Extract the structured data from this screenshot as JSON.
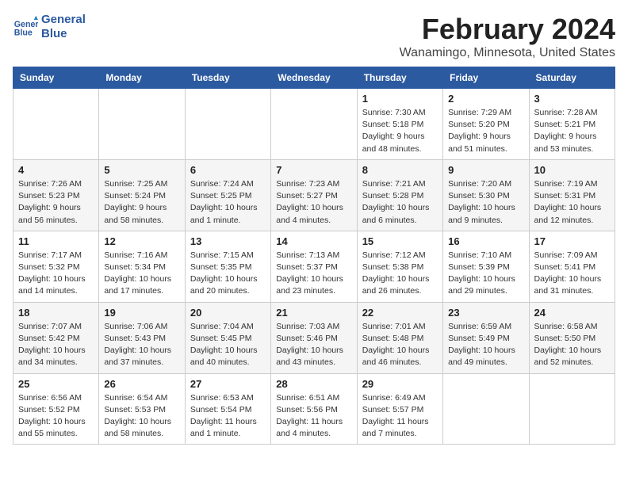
{
  "header": {
    "logo_line1": "General",
    "logo_line2": "Blue",
    "month_year": "February 2024",
    "location": "Wanamingo, Minnesota, United States"
  },
  "weekdays": [
    "Sunday",
    "Monday",
    "Tuesday",
    "Wednesday",
    "Thursday",
    "Friday",
    "Saturday"
  ],
  "weeks": [
    [
      {
        "day": "",
        "info": ""
      },
      {
        "day": "",
        "info": ""
      },
      {
        "day": "",
        "info": ""
      },
      {
        "day": "",
        "info": ""
      },
      {
        "day": "1",
        "info": "Sunrise: 7:30 AM\nSunset: 5:18 PM\nDaylight: 9 hours\nand 48 minutes."
      },
      {
        "day": "2",
        "info": "Sunrise: 7:29 AM\nSunset: 5:20 PM\nDaylight: 9 hours\nand 51 minutes."
      },
      {
        "day": "3",
        "info": "Sunrise: 7:28 AM\nSunset: 5:21 PM\nDaylight: 9 hours\nand 53 minutes."
      }
    ],
    [
      {
        "day": "4",
        "info": "Sunrise: 7:26 AM\nSunset: 5:23 PM\nDaylight: 9 hours\nand 56 minutes."
      },
      {
        "day": "5",
        "info": "Sunrise: 7:25 AM\nSunset: 5:24 PM\nDaylight: 9 hours\nand 58 minutes."
      },
      {
        "day": "6",
        "info": "Sunrise: 7:24 AM\nSunset: 5:25 PM\nDaylight: 10 hours\nand 1 minute."
      },
      {
        "day": "7",
        "info": "Sunrise: 7:23 AM\nSunset: 5:27 PM\nDaylight: 10 hours\nand 4 minutes."
      },
      {
        "day": "8",
        "info": "Sunrise: 7:21 AM\nSunset: 5:28 PM\nDaylight: 10 hours\nand 6 minutes."
      },
      {
        "day": "9",
        "info": "Sunrise: 7:20 AM\nSunset: 5:30 PM\nDaylight: 10 hours\nand 9 minutes."
      },
      {
        "day": "10",
        "info": "Sunrise: 7:19 AM\nSunset: 5:31 PM\nDaylight: 10 hours\nand 12 minutes."
      }
    ],
    [
      {
        "day": "11",
        "info": "Sunrise: 7:17 AM\nSunset: 5:32 PM\nDaylight: 10 hours\nand 14 minutes."
      },
      {
        "day": "12",
        "info": "Sunrise: 7:16 AM\nSunset: 5:34 PM\nDaylight: 10 hours\nand 17 minutes."
      },
      {
        "day": "13",
        "info": "Sunrise: 7:15 AM\nSunset: 5:35 PM\nDaylight: 10 hours\nand 20 minutes."
      },
      {
        "day": "14",
        "info": "Sunrise: 7:13 AM\nSunset: 5:37 PM\nDaylight: 10 hours\nand 23 minutes."
      },
      {
        "day": "15",
        "info": "Sunrise: 7:12 AM\nSunset: 5:38 PM\nDaylight: 10 hours\nand 26 minutes."
      },
      {
        "day": "16",
        "info": "Sunrise: 7:10 AM\nSunset: 5:39 PM\nDaylight: 10 hours\nand 29 minutes."
      },
      {
        "day": "17",
        "info": "Sunrise: 7:09 AM\nSunset: 5:41 PM\nDaylight: 10 hours\nand 31 minutes."
      }
    ],
    [
      {
        "day": "18",
        "info": "Sunrise: 7:07 AM\nSunset: 5:42 PM\nDaylight: 10 hours\nand 34 minutes."
      },
      {
        "day": "19",
        "info": "Sunrise: 7:06 AM\nSunset: 5:43 PM\nDaylight: 10 hours\nand 37 minutes."
      },
      {
        "day": "20",
        "info": "Sunrise: 7:04 AM\nSunset: 5:45 PM\nDaylight: 10 hours\nand 40 minutes."
      },
      {
        "day": "21",
        "info": "Sunrise: 7:03 AM\nSunset: 5:46 PM\nDaylight: 10 hours\nand 43 minutes."
      },
      {
        "day": "22",
        "info": "Sunrise: 7:01 AM\nSunset: 5:48 PM\nDaylight: 10 hours\nand 46 minutes."
      },
      {
        "day": "23",
        "info": "Sunrise: 6:59 AM\nSunset: 5:49 PM\nDaylight: 10 hours\nand 49 minutes."
      },
      {
        "day": "24",
        "info": "Sunrise: 6:58 AM\nSunset: 5:50 PM\nDaylight: 10 hours\nand 52 minutes."
      }
    ],
    [
      {
        "day": "25",
        "info": "Sunrise: 6:56 AM\nSunset: 5:52 PM\nDaylight: 10 hours\nand 55 minutes."
      },
      {
        "day": "26",
        "info": "Sunrise: 6:54 AM\nSunset: 5:53 PM\nDaylight: 10 hours\nand 58 minutes."
      },
      {
        "day": "27",
        "info": "Sunrise: 6:53 AM\nSunset: 5:54 PM\nDaylight: 11 hours\nand 1 minute."
      },
      {
        "day": "28",
        "info": "Sunrise: 6:51 AM\nSunset: 5:56 PM\nDaylight: 11 hours\nand 4 minutes."
      },
      {
        "day": "29",
        "info": "Sunrise: 6:49 AM\nSunset: 5:57 PM\nDaylight: 11 hours\nand 7 minutes."
      },
      {
        "day": "",
        "info": ""
      },
      {
        "day": "",
        "info": ""
      }
    ]
  ]
}
